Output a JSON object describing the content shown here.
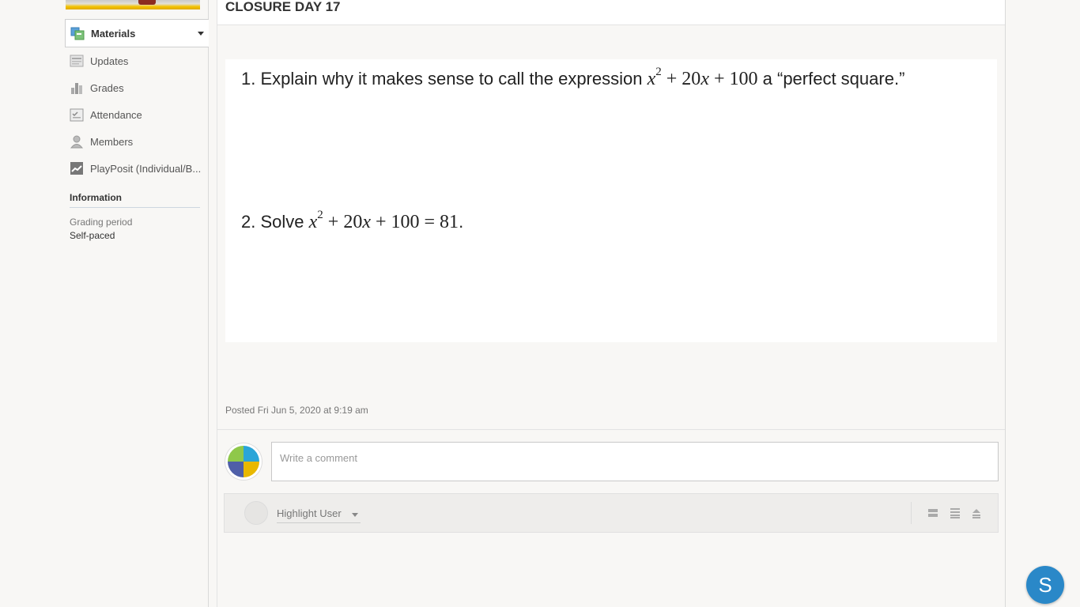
{
  "sidebar": {
    "nav": [
      {
        "label": "Materials",
        "icon": "materials-icon",
        "active": true
      },
      {
        "label": "Updates",
        "icon": "updates-icon"
      },
      {
        "label": "Grades",
        "icon": "grades-icon"
      },
      {
        "label": "Attendance",
        "icon": "attendance-icon"
      },
      {
        "label": "Members",
        "icon": "members-icon"
      },
      {
        "label": "PlayPosit (Individual/B...",
        "icon": "playposit-icon"
      }
    ],
    "information": {
      "title": "Information",
      "grading_period_label": "Grading period",
      "grading_period_value": "Self-paced"
    }
  },
  "main": {
    "title": "CLOSURE DAY 17",
    "questions": [
      {
        "prefix": "1. Explain why it makes sense to call the expression",
        "math_expr": "x^2 + 20x + 100",
        "suffix": "a “perfect square.”"
      },
      {
        "prefix": "2. Solve",
        "math_expr": "x^2 + 20x + 100 = 81",
        "suffix": "."
      }
    ],
    "posted": "Posted Fri Jun 5, 2020 at 9:19 am",
    "comment_placeholder": "Write a comment",
    "highlight_user": "Highlight User"
  },
  "fab": {
    "label": "S",
    "color": "#2a88c8"
  }
}
